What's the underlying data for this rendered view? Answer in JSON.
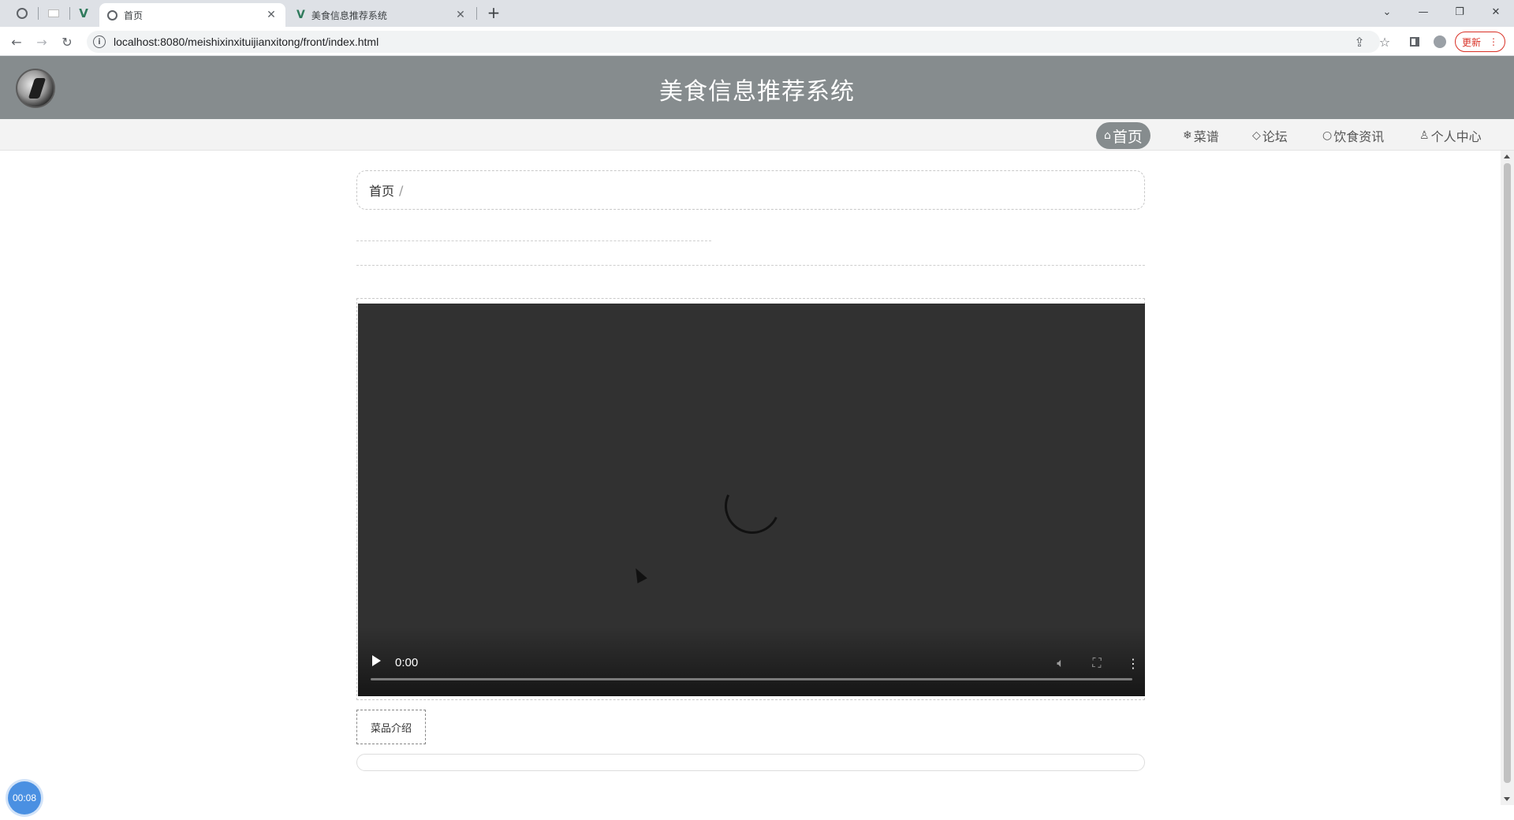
{
  "browser": {
    "tabs": [
      {
        "title": "首页",
        "active": true
      },
      {
        "title": "美食信息推荐系统",
        "active": false
      }
    ],
    "url": "localhost:8080/meishixinxituijianxitong/front/index.html",
    "update_label": "更新"
  },
  "header": {
    "title": "美食信息推荐系统"
  },
  "nav": {
    "items": [
      {
        "label": "首页",
        "icon": "⌂"
      },
      {
        "label": "菜谱",
        "icon": "❄"
      },
      {
        "label": "论坛",
        "icon": "◇"
      },
      {
        "label": "饮食资讯",
        "icon": "○"
      },
      {
        "label": "个人中心",
        "icon": "♙"
      }
    ]
  },
  "breadcrumb": {
    "home": "首页",
    "separator": "/"
  },
  "video": {
    "time": "0:00",
    "progress": 0
  },
  "detail": {
    "intro_tab_label": "菜品介绍"
  },
  "overlay": {
    "timer": "00:08"
  },
  "colors": {
    "header_bg": "#868c8e",
    "nav_active_bg": "#868c8e",
    "video_bg": "#313131",
    "timer_badge": "#4a90e2"
  }
}
